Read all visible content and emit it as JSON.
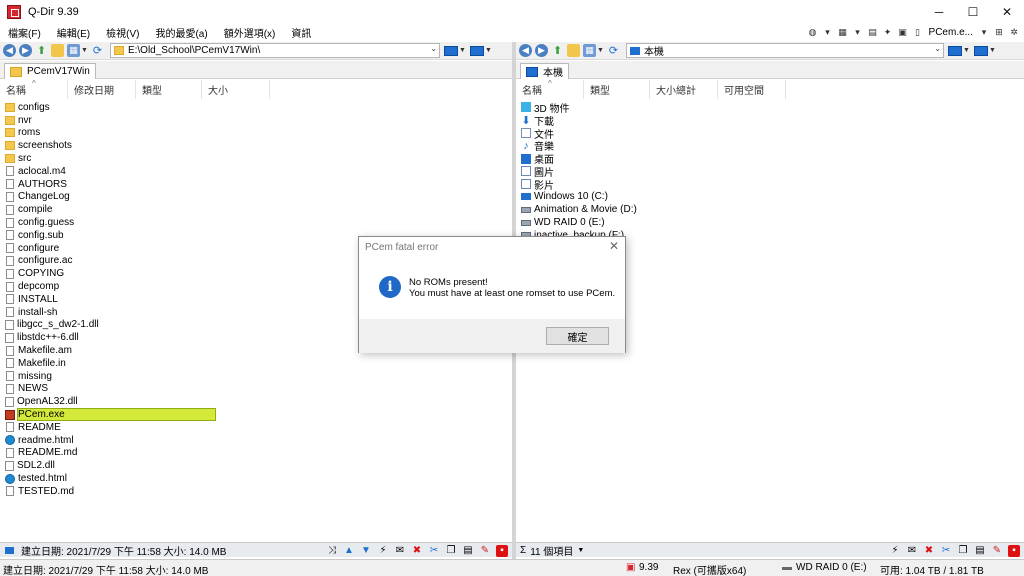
{
  "window": {
    "title": "Q-Dir 9.39",
    "minimize": "─",
    "maximize": "☐",
    "close": "✕"
  },
  "menu": {
    "items": [
      "檔案(F)",
      "編輯(E)",
      "檢視(V)",
      "我的最愛(a)",
      "額外選項(x)",
      "資訊"
    ],
    "right_label": "PCem.e..."
  },
  "left_pane": {
    "address": "E:\\Old_School\\PCemV17Win\\",
    "tab": "PCemV17Win",
    "columns": [
      "名稱",
      "修改日期",
      "類型",
      "大小"
    ],
    "files": [
      {
        "name": "configs",
        "icon": "folder-icon"
      },
      {
        "name": "nvr",
        "icon": "folder-icon"
      },
      {
        "name": "roms",
        "icon": "folder-icon"
      },
      {
        "name": "screenshots",
        "icon": "folder-icon"
      },
      {
        "name": "src",
        "icon": "folder-icon"
      },
      {
        "name": "aclocal.m4",
        "icon": "file-icon"
      },
      {
        "name": "AUTHORS",
        "icon": "file-icon"
      },
      {
        "name": "ChangeLog",
        "icon": "file-icon"
      },
      {
        "name": "compile",
        "icon": "file-icon"
      },
      {
        "name": "config.guess",
        "icon": "file-icon"
      },
      {
        "name": "config.sub",
        "icon": "file-icon"
      },
      {
        "name": "configure",
        "icon": "file-icon"
      },
      {
        "name": "configure.ac",
        "icon": "file-icon"
      },
      {
        "name": "COPYING",
        "icon": "file-icon"
      },
      {
        "name": "depcomp",
        "icon": "file-icon"
      },
      {
        "name": "INSTALL",
        "icon": "file-icon"
      },
      {
        "name": "install-sh",
        "icon": "file-icon"
      },
      {
        "name": "libgcc_s_dw2-1.dll",
        "icon": "dll-icon"
      },
      {
        "name": "libstdc++-6.dll",
        "icon": "dll-icon"
      },
      {
        "name": "Makefile.am",
        "icon": "file-icon"
      },
      {
        "name": "Makefile.in",
        "icon": "file-icon"
      },
      {
        "name": "missing",
        "icon": "file-icon"
      },
      {
        "name": "NEWS",
        "icon": "file-icon"
      },
      {
        "name": "OpenAL32.dll",
        "icon": "dll-icon"
      },
      {
        "name": "PCem.exe",
        "icon": "exe-icon",
        "selected": true
      },
      {
        "name": "README",
        "icon": "file-icon"
      },
      {
        "name": "readme.html",
        "icon": "edge-icon"
      },
      {
        "name": "README.md",
        "icon": "file-icon"
      },
      {
        "name": "SDL2.dll",
        "icon": "dll-icon"
      },
      {
        "name": "tested.html",
        "icon": "edge-icon"
      },
      {
        "name": "TESTED.md",
        "icon": "file-icon"
      }
    ],
    "status": "建立日期: 2021/7/29 下午 11:58 大小: 14.0 MB"
  },
  "right_pane": {
    "address": "本機",
    "tab": "本機",
    "columns": [
      "名稱",
      "類型",
      "大小總計",
      "可用空間"
    ],
    "items": [
      {
        "name": "3D 物件",
        "icon": "3d-objects-icon"
      },
      {
        "name": "下載",
        "icon": "downloads-icon"
      },
      {
        "name": "文件",
        "icon": "documents-icon"
      },
      {
        "name": "音樂",
        "icon": "music-icon"
      },
      {
        "name": "桌面",
        "icon": "desktop-icon"
      },
      {
        "name": "圖片",
        "icon": "pictures-icon"
      },
      {
        "name": "影片",
        "icon": "videos-icon"
      },
      {
        "name": "Windows 10 (C:)",
        "icon": "windows-drive-icon"
      },
      {
        "name": "Animation & Movie (D:)",
        "icon": "drive-icon"
      },
      {
        "name": "WD RAID 0 (E:)",
        "icon": "drive-icon"
      },
      {
        "name": "inactive_backup (F:)",
        "icon": "drive-icon"
      }
    ],
    "status": "11 個項目"
  },
  "global_status": {
    "created": "建立日期: 2021/7/29 下午 11:58 大小: 14.0 MB",
    "version": "9.39",
    "user": "Rex (可攜版x64)",
    "drive": "WD RAID 0 (E:)",
    "space": "可用: 1.04 TB / 1.81 TB"
  },
  "dialog": {
    "title": "PCem fatal error",
    "line1": "No ROMs present!",
    "line2": "You must have at least one romset to use PCem.",
    "ok": "確定",
    "close": "✕",
    "icon_glyph": "i"
  },
  "colors": {
    "selection": "#d4e93a",
    "accent": "#1e6fcf",
    "info_icon": "#1f68c7"
  }
}
